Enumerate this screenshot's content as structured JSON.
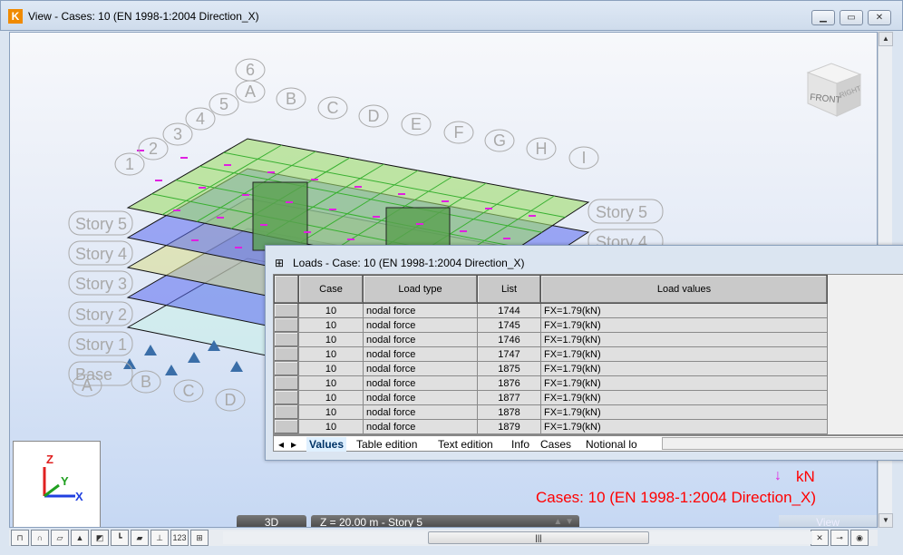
{
  "window": {
    "title": "View - Cases: 10 (EN 1998-1:2004 Direction_X)",
    "app_icon": "K"
  },
  "model": {
    "number_axes": [
      "1",
      "2",
      "3",
      "4",
      "5",
      "6"
    ],
    "letter_axes_top": [
      "A",
      "B",
      "C",
      "D",
      "E",
      "F",
      "G",
      "H",
      "I"
    ],
    "letter_axes_bottom": [
      "A",
      "B",
      "C",
      "D"
    ],
    "stories_left": [
      "Story 5",
      "Story 4",
      "Story 3",
      "Story 2",
      "Story 1",
      "Base"
    ],
    "stories_right": [
      "Story 5",
      "Story 4"
    ]
  },
  "viewcube": {
    "front": "FRONT",
    "right": "RIGHT"
  },
  "axes": {
    "z": "Z",
    "y": "Y",
    "x": "X"
  },
  "legend": {
    "unit": "kN",
    "cases": "Cases: 10 (EN 1998-1:2004 Direction_X)"
  },
  "bottom": {
    "mode_3d": "3D",
    "z_level": "Z = 20.00 m - Story 5",
    "view": "View"
  },
  "loads": {
    "title": "Loads - Case: 10 (EN 1998-1:2004 Direction_X)",
    "columns": [
      "Case",
      "Load type",
      "List",
      "Load values"
    ],
    "rows": [
      [
        "10",
        "nodal force",
        "1744",
        "FX=1.79(kN)"
      ],
      [
        "10",
        "nodal force",
        "1745",
        "FX=1.79(kN)"
      ],
      [
        "10",
        "nodal force",
        "1746",
        "FX=1.79(kN)"
      ],
      [
        "10",
        "nodal force",
        "1747",
        "FX=1.79(kN)"
      ],
      [
        "10",
        "nodal force",
        "1875",
        "FX=1.79(kN)"
      ],
      [
        "10",
        "nodal force",
        "1876",
        "FX=1.79(kN)"
      ],
      [
        "10",
        "nodal force",
        "1877",
        "FX=1.79(kN)"
      ],
      [
        "10",
        "nodal force",
        "1878",
        "FX=1.79(kN)"
      ],
      [
        "10",
        "nodal force",
        "1879",
        "FX=1.79(kN)"
      ]
    ],
    "tabs": [
      "Values",
      "Table edition",
      "Text edition",
      "Info",
      "Cases",
      "Notional lo"
    ]
  },
  "colors": {
    "legend": "#ff0000",
    "slab_green": "#9fdc6a",
    "slab_blue": "#5a6af0",
    "slab_yellow": "#d8dc8a",
    "loads": "#e020e0"
  }
}
